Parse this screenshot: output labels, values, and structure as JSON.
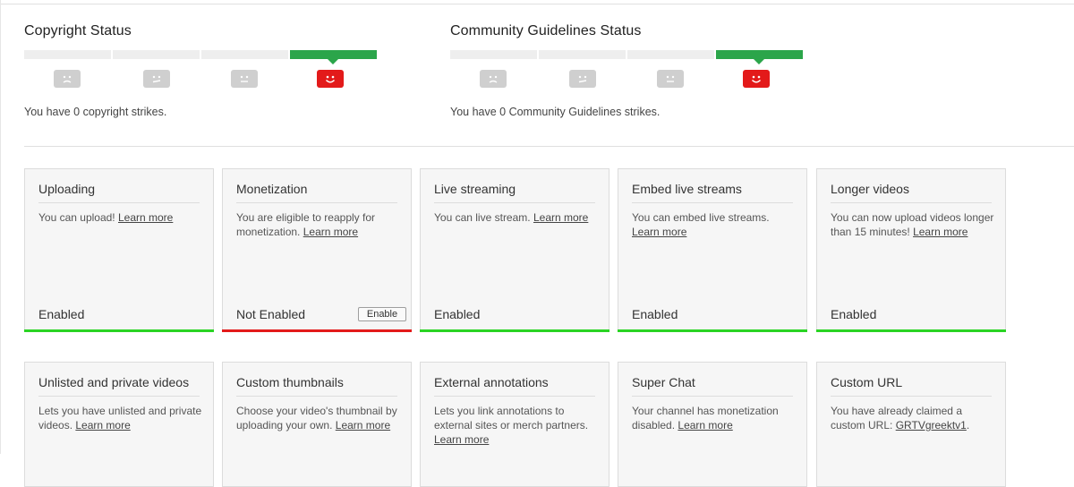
{
  "copyright": {
    "title": "Copyright Status",
    "strikes_text": "You have 0 copyright strikes.",
    "level": 3
  },
  "community": {
    "title": "Community Guidelines Status",
    "strikes_text": "You have 0 Community Guidelines strikes.",
    "level": 3
  },
  "colors": {
    "active_meter": "#2ba54a",
    "active_face": "#e31a1a",
    "inactive_face": "#cfcfcf",
    "enabled_bar": "#2ad424",
    "not_enabled_bar": "#e31a1a"
  },
  "features": [
    {
      "title": "Uploading",
      "desc": "You can upload!",
      "link": "Learn more",
      "state": "Enabled"
    },
    {
      "title": "Monetization",
      "desc": "You are eligible to reapply for monetization.",
      "link": "Learn more",
      "state": "Not Enabled",
      "button": "Enable"
    },
    {
      "title": "Live streaming",
      "desc": "You can live stream.",
      "link": "Learn more",
      "state": "Enabled"
    },
    {
      "title": "Embed live streams",
      "desc": "You can embed live streams.",
      "link": "Learn more",
      "state": "Enabled"
    },
    {
      "title": "Longer videos",
      "desc": "You can now upload videos longer than 15 minutes!",
      "link": "Learn more",
      "state": "Enabled"
    },
    {
      "title": "Unlisted and private videos",
      "desc": "Lets you have unlisted and private videos.",
      "link": "Learn more"
    },
    {
      "title": "Custom thumbnails",
      "desc": "Choose your video's thumbnail by uploading your own.",
      "link": "Learn more"
    },
    {
      "title": "External annotations",
      "desc": "Lets you link annotations to external sites or merch partners.",
      "link": "Learn more"
    },
    {
      "title": "Super Chat",
      "desc": "Your channel has monetization disabled.",
      "link": "Learn more"
    },
    {
      "title": "Custom URL",
      "desc": "You have already claimed a custom URL:",
      "link": "GRTVgreektv1",
      "suffix": "."
    }
  ]
}
